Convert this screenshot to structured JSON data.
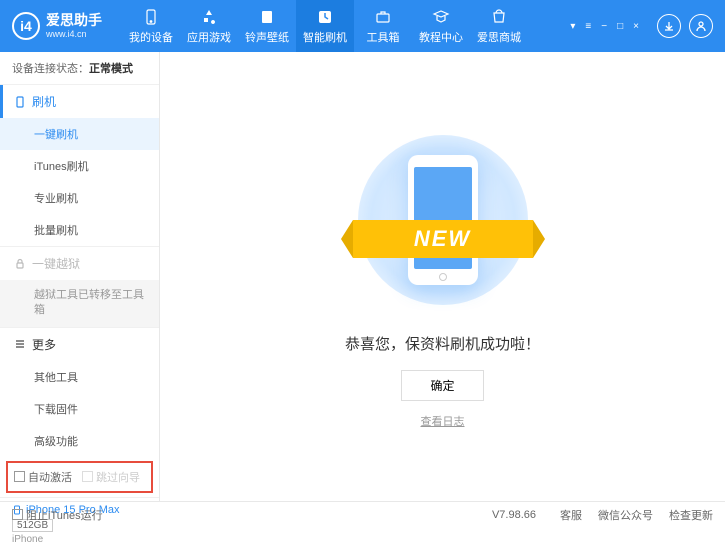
{
  "header": {
    "logo_title": "爱思助手",
    "logo_url": "www.i4.cn",
    "nav": [
      {
        "label": "我的设备"
      },
      {
        "label": "应用游戏"
      },
      {
        "label": "铃声壁纸"
      },
      {
        "label": "智能刷机"
      },
      {
        "label": "工具箱"
      },
      {
        "label": "教程中心"
      },
      {
        "label": "爱思商城"
      }
    ]
  },
  "status": {
    "label": "设备连接状态：",
    "value": "正常模式"
  },
  "sidebar": {
    "flash": {
      "title": "刷机",
      "items": [
        "一键刷机",
        "iTunes刷机",
        "专业刷机",
        "批量刷机"
      ]
    },
    "jailbreak": {
      "title": "一键越狱",
      "note": "越狱工具已转移至工具箱"
    },
    "more": {
      "title": "更多",
      "items": [
        "其他工具",
        "下载固件",
        "高级功能"
      ]
    },
    "options": {
      "auto_activate": "自动激活",
      "skip_guide": "跳过向导"
    },
    "device": {
      "name": "iPhone 15 Pro Max",
      "storage": "512GB",
      "type": "iPhone"
    }
  },
  "main": {
    "ribbon": "NEW",
    "success": "恭喜您，保资料刷机成功啦！",
    "ok": "确定",
    "view_log": "查看日志"
  },
  "footer": {
    "block_itunes": "阻止iTunes运行",
    "version": "V7.98.66",
    "links": [
      "客服",
      "微信公众号",
      "检查更新"
    ]
  }
}
